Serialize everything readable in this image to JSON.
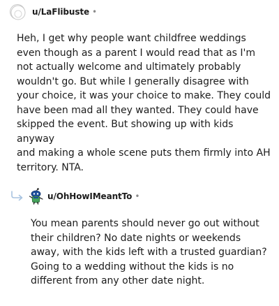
{
  "comments": [
    {
      "username": "u/LaFlibuste",
      "separator": "•",
      "avatar": "avatar-outline-icon",
      "body_lines": [
        "Heh, I get why people want childfree weddings",
        "even though as a parent I would read that as I'm",
        "not actually welcome and ultimately probably",
        "wouldn't go. But while I generally disagree with",
        "your choice, it was your choice to make. They could",
        "have been mad all they wanted. They could have",
        "skipped the event. But showing up with kids anyway",
        "and making a whole scene puts them firmly into AH",
        "territory. NTA."
      ]
    },
    {
      "username": "u/OhHowIMeantTo",
      "separator": "•",
      "avatar": "snoo-avatar-icon",
      "reply_icon": "reply-arrow-icon",
      "body_lines": [
        "You mean parents should never go out without",
        "their children? No date nights or weekends",
        "away, with the kids left with a trusted guardian?",
        "Going to a wedding without the kids is no",
        "different from any other date night."
      ]
    }
  ],
  "colors": {
    "text": "#1c1c1c",
    "muted": "#8a8a8a",
    "reply_arrow": "#a8c3e0",
    "avatar_blue": "#1e4f9c",
    "avatar_green": "#46a35c"
  }
}
